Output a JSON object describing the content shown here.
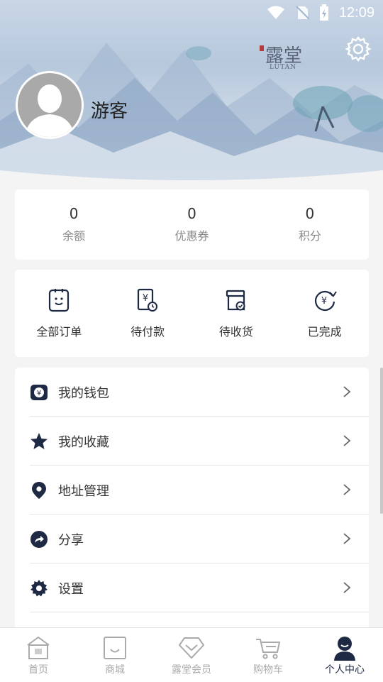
{
  "status_bar": {
    "time": "12:09"
  },
  "brand": {
    "cn": "露堂",
    "en": "LUTAN"
  },
  "profile": {
    "username": "游客"
  },
  "stats": [
    {
      "value": "0",
      "label": "余额"
    },
    {
      "value": "0",
      "label": "优惠券"
    },
    {
      "value": "0",
      "label": "积分"
    }
  ],
  "orders": [
    {
      "label": "全部订单",
      "icon": "clipboard-face-icon"
    },
    {
      "label": "待付款",
      "icon": "yen-bill-clock-icon"
    },
    {
      "label": "待收货",
      "icon": "box-check-icon"
    },
    {
      "label": "已完成",
      "icon": "yen-refresh-icon"
    }
  ],
  "menu": [
    {
      "label": "我的钱包",
      "icon": "wallet-icon"
    },
    {
      "label": "我的收藏",
      "icon": "star-icon"
    },
    {
      "label": "地址管理",
      "icon": "location-pin-icon"
    },
    {
      "label": "分享",
      "icon": "share-arrow-icon"
    },
    {
      "label": "设置",
      "icon": "gear-icon"
    }
  ],
  "tabs": [
    {
      "label": "首页",
      "icon": "home-icon"
    },
    {
      "label": "商城",
      "icon": "shopping-bag-icon"
    },
    {
      "label": "露堂会员",
      "icon": "diamond-icon"
    },
    {
      "label": "购物车",
      "icon": "cart-icon"
    },
    {
      "label": "个人中心",
      "icon": "person-icon",
      "active": true
    }
  ],
  "colors": {
    "accent": "#1e2a44",
    "inactive": "#aaaaaa",
    "background": "#f4f4f4"
  }
}
